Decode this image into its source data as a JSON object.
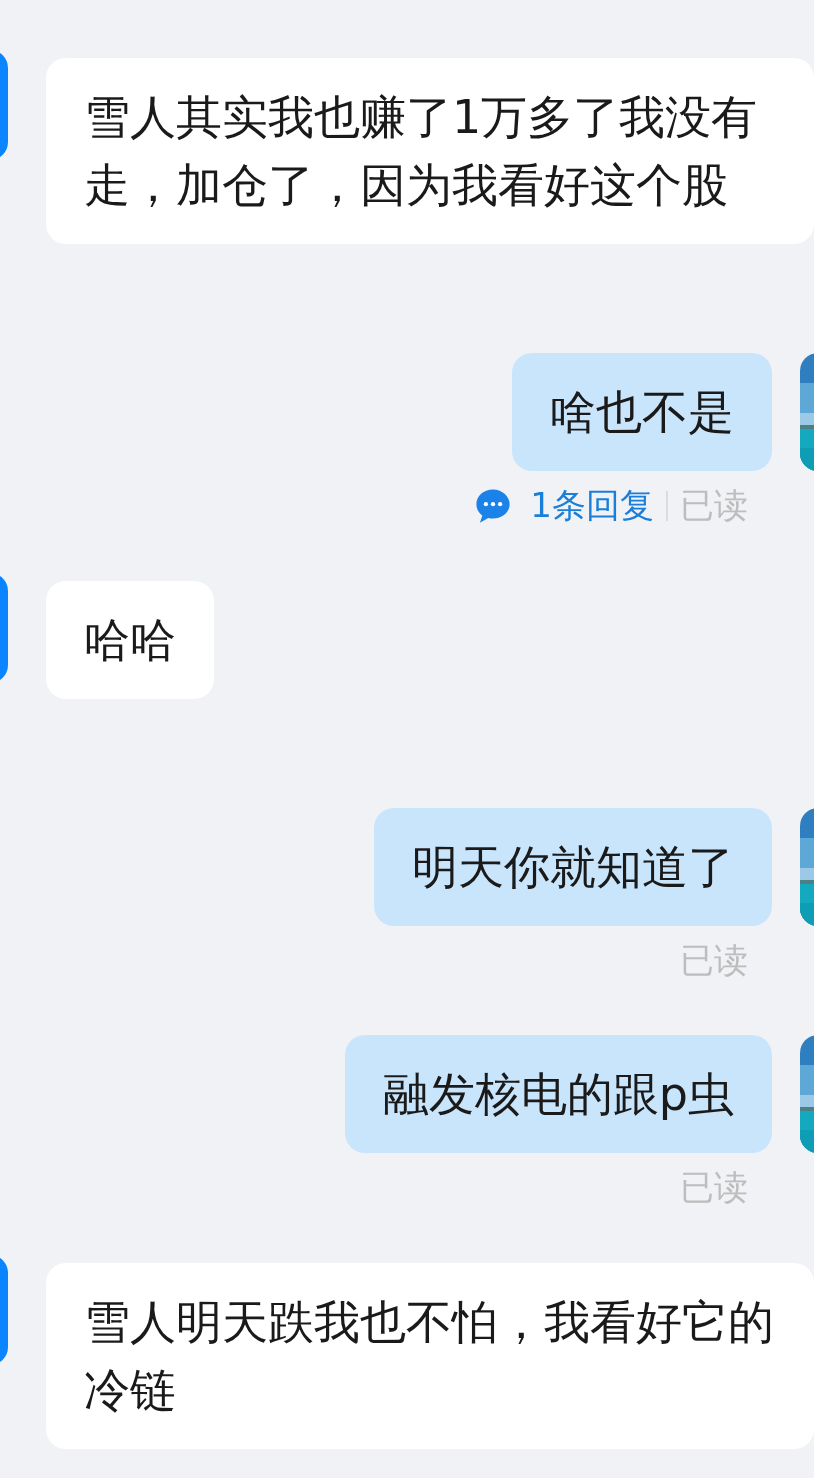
{
  "messages": [
    {
      "kind": "left",
      "text": "雪人其实我也赚了1万多了我没有走，加仓了，因为我看好这个股"
    },
    {
      "kind": "right",
      "text": "啥也不是",
      "replies": "1条回复",
      "status": "已读"
    },
    {
      "kind": "left",
      "text": "哈哈"
    },
    {
      "kind": "right",
      "text": "明天你就知道了",
      "status": "已读"
    },
    {
      "kind": "right",
      "text": "融发核电的跟p虫",
      "status": "已读"
    },
    {
      "kind": "left",
      "text": "雪人明天跌我也不怕，我看好它的冷链"
    }
  ]
}
